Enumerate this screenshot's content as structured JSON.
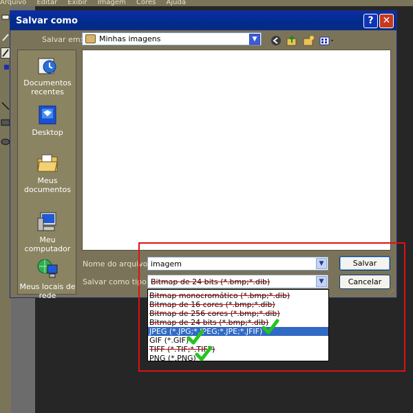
{
  "app": {
    "menu": [
      "Arquivo",
      "Editar",
      "Exibir",
      "Imagem",
      "Cores",
      "Ajuda"
    ]
  },
  "dialog": {
    "title": "Salvar como",
    "help_label": "?",
    "close_label": "✕",
    "save_in_label": "Salvar em:",
    "save_in_value": "Minhas imagens",
    "places": [
      {
        "label": "Documentos recentes",
        "icon": "recent-documents-icon"
      },
      {
        "label": "Desktop",
        "icon": "desktop-icon"
      },
      {
        "label": "Meus documentos",
        "icon": "my-documents-icon"
      },
      {
        "label": "Meu computador",
        "icon": "my-computer-icon"
      },
      {
        "label": "Meus locais de rede",
        "icon": "network-places-icon"
      }
    ],
    "filename_label": "Nome do arquivo:",
    "filename_value": "imagem",
    "filetype_label": "Salvar como tipo:",
    "filetype_value": "Bitmap de 24 bits (*.bmp;*.dib)",
    "save_button": "Salvar",
    "cancel_button": "Cancelar"
  },
  "dropdown": {
    "options": [
      {
        "label": "Bitmap monocromático (*.bmp;*.dib)",
        "struck": true,
        "selected": false,
        "checked": false
      },
      {
        "label": "Bitmap de 16 cores (*.bmp;*.dib)",
        "struck": true,
        "selected": false,
        "checked": false
      },
      {
        "label": "Bitmap de 256 cores (*.bmp;*.dib)",
        "struck": true,
        "selected": false,
        "checked": false
      },
      {
        "label": "Bitmap de 24 bits (*.bmp;*.dib)",
        "struck": true,
        "selected": false,
        "checked": false
      },
      {
        "label": "JPEG (*.JPG;*.JPEG;*.JPE;*.JFIF)",
        "struck": false,
        "selected": true,
        "checked": true
      },
      {
        "label": "GIF (*.GIF)",
        "struck": false,
        "selected": false,
        "checked": true
      },
      {
        "label": "TIFF (*.TIF;*.TIFF)",
        "struck": true,
        "selected": false,
        "checked": false
      },
      {
        "label": "PNG (*.PNG)",
        "struck": false,
        "selected": false,
        "checked": true
      }
    ]
  },
  "colors": {
    "highlight_box": "#e01010",
    "checkmark": "#22c51e",
    "selection": "#316ac5"
  }
}
